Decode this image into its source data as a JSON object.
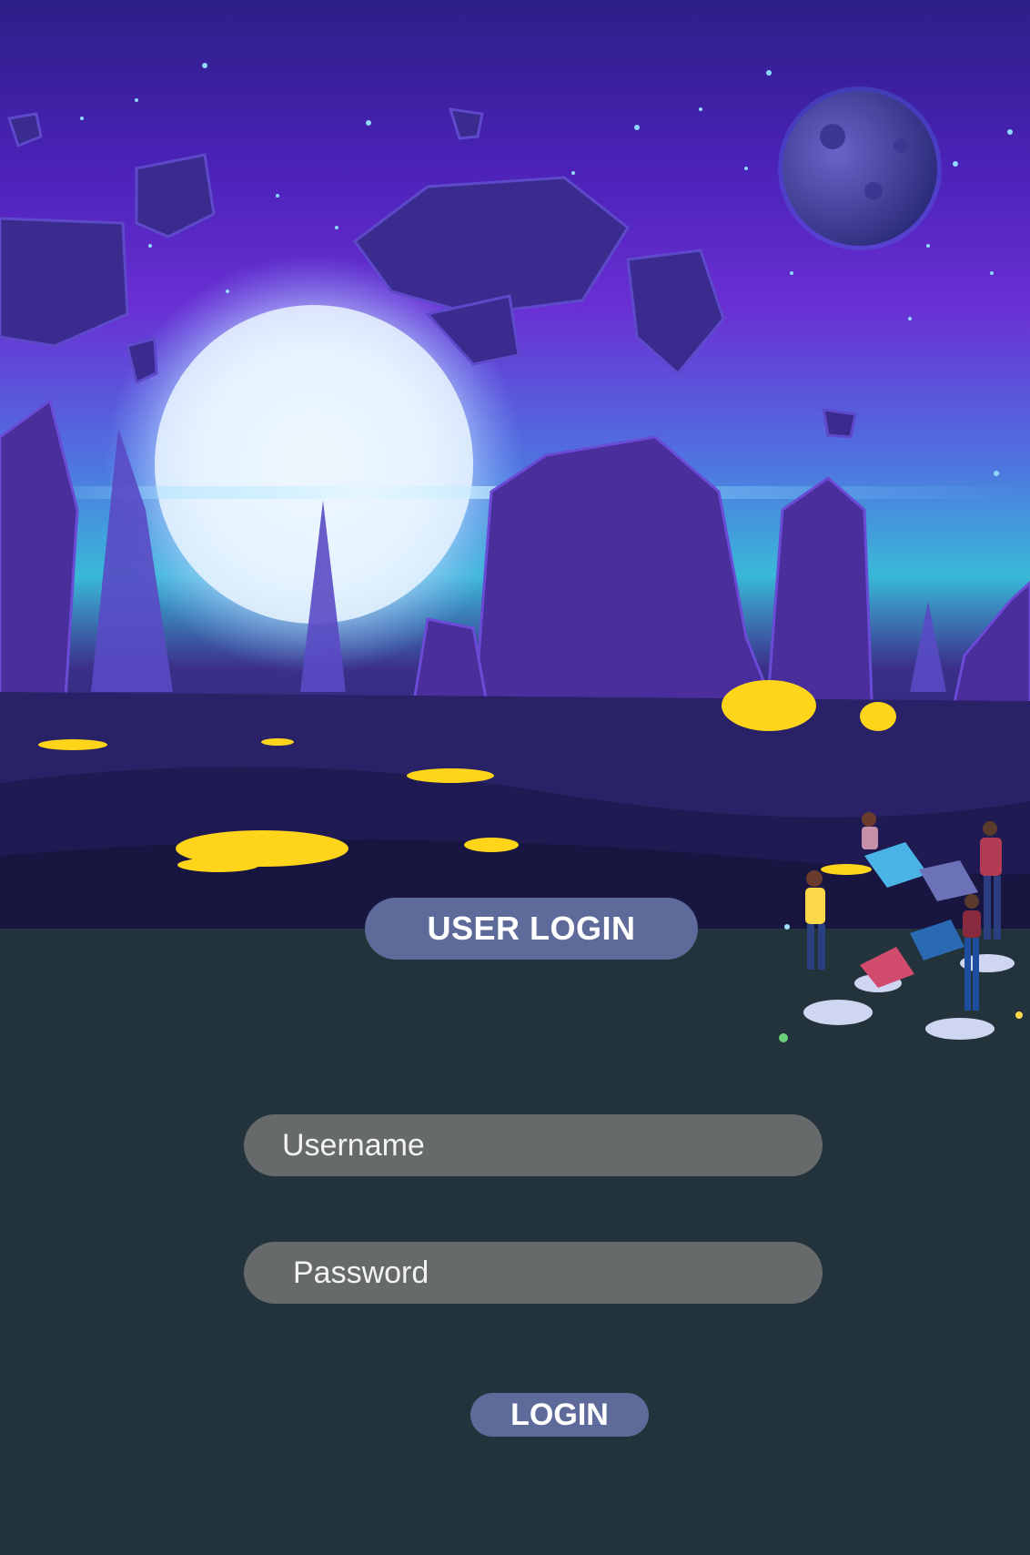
{
  "header": {
    "title": "USER LOGIN"
  },
  "form": {
    "username_placeholder": "Username",
    "password_placeholder": "Password",
    "submit_label": "LOGIN"
  },
  "colors": {
    "background": "#22333b",
    "pill": "#5e6a9a",
    "field": "#676a6a",
    "text": "#ffffff"
  },
  "illustrations": {
    "hero": "alien-landscape-illustration",
    "team": "team-puzzle-illustration"
  }
}
